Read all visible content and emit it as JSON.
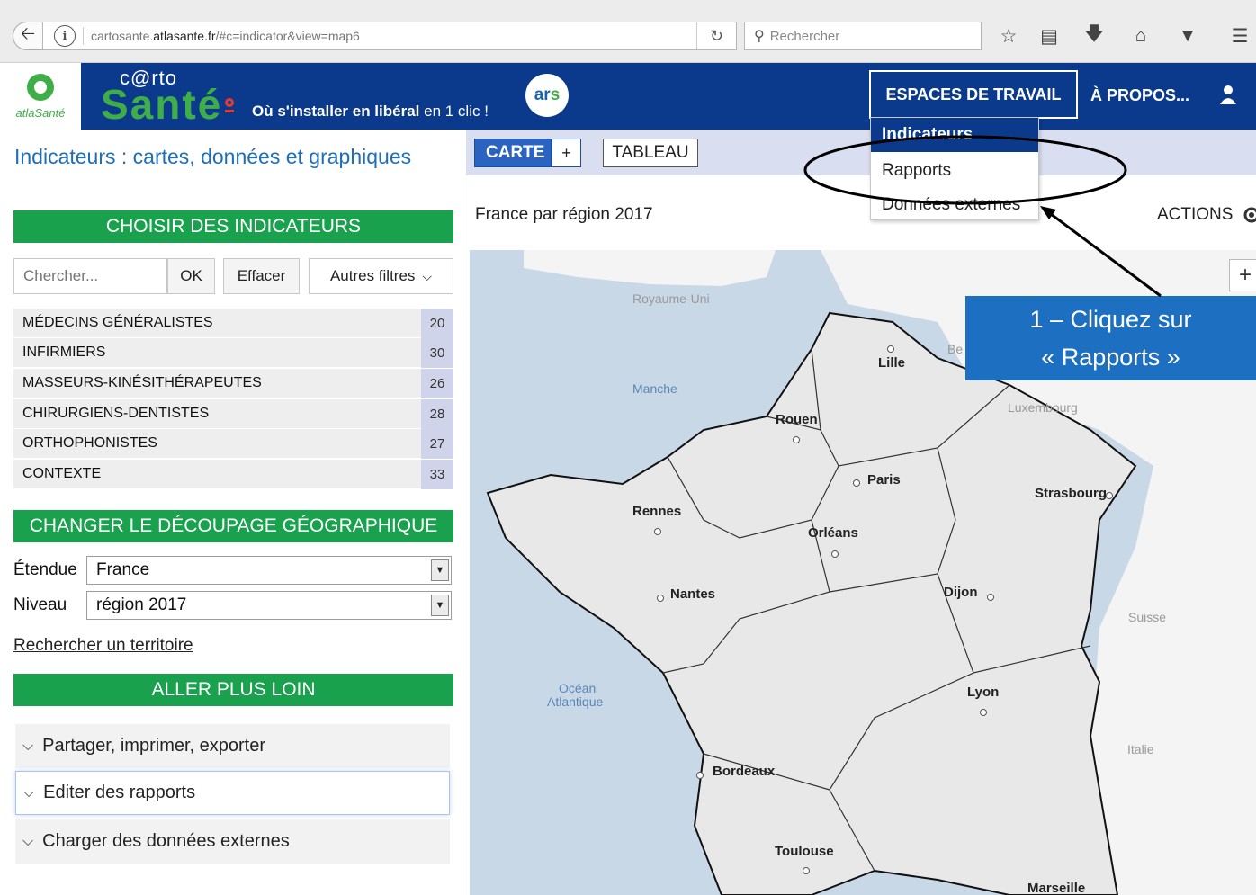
{
  "browser": {
    "url_prefix": "cartosante.",
    "url_domain": "atlasante.fr",
    "url_suffix": "/#c=indicator&view=map6",
    "search_placeholder": "Rechercher"
  },
  "header": {
    "logo_text": "atlaSanté",
    "brand_small": "c@rto",
    "brand_big": "Santé",
    "tagline_bold": "Où s'installer en libéral",
    "tagline_rest": " en 1 clic !",
    "ars_text_1": "ar",
    "ars_text_2": "s",
    "nav_workspace": "ESPACES DE TRAVAIL",
    "nav_about": "À PROPOS..."
  },
  "dropdown": {
    "items": [
      "Indicateurs",
      "Rapports",
      "Données externes"
    ]
  },
  "sidebar": {
    "title": "Indicateurs : cartes, données et graphiques",
    "choose_header": "CHOISIR DES INDICATEURS",
    "search_placeholder": "Chercher...",
    "ok_label": "OK",
    "clear_label": "Effacer",
    "filters_label": "Autres filtres",
    "categories": [
      {
        "label": "Médecins généralistes",
        "count": "20"
      },
      {
        "label": "Infirmiers",
        "count": "30"
      },
      {
        "label": "Masseurs-kinésithérapeutes",
        "count": "26"
      },
      {
        "label": "Chirurgiens-dentistes",
        "count": "28"
      },
      {
        "label": "Orthophonistes",
        "count": "27"
      },
      {
        "label": "Contexte",
        "count": "33"
      }
    ],
    "geo_header": "CHANGER LE DÉCOUPAGE GÉOGRAPHIQUE",
    "extent_label": "Étendue",
    "extent_value": "France",
    "level_label": "Niveau",
    "level_value": "région 2017",
    "search_territory": "Rechercher un territoire",
    "further_header": "ALLER PLUS LOIN",
    "accordions": [
      "Partager, imprimer, exporter",
      "Editer des rapports",
      "Charger des données externes"
    ]
  },
  "main": {
    "tab_map": "CARTE",
    "tab_plus": "+",
    "tab_table": "TABLEAU",
    "map_title": "France par région 2017",
    "actions": "ACTIONS",
    "zoom_in": "+"
  },
  "map": {
    "countries": [
      "Royaume-Uni",
      "Be",
      "Luxembourg",
      "Suisse",
      "Italie"
    ],
    "seas": [
      "Manche",
      "Océan",
      "Atlantique"
    ],
    "cities": [
      "Lille",
      "Rouen",
      "Paris",
      "Strasbourg",
      "Rennes",
      "Orléans",
      "Nantes",
      "Dijon",
      "Lyon",
      "Bordeaux",
      "Toulouse",
      "Marseille"
    ]
  },
  "annotation": {
    "line1": "1 – Cliquez sur",
    "line2": "« Rapports »"
  },
  "colors": {
    "header_blue": "#0b3a8c",
    "green": "#19a14d",
    "callout_blue": "#1c6fc1",
    "link_blue": "#1e6fb8"
  }
}
